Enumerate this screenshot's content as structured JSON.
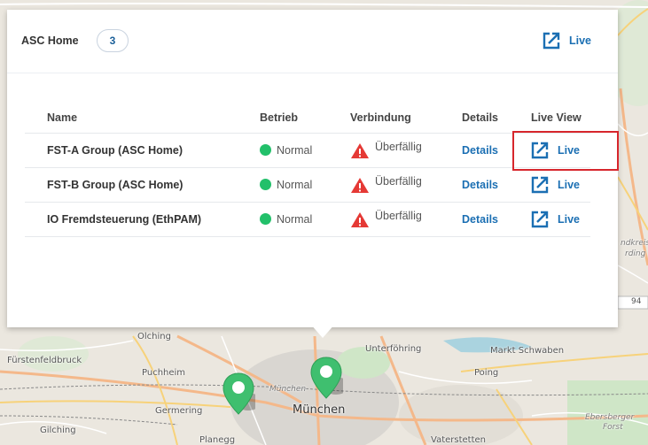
{
  "map": {
    "labels": [
      {
        "id": "olching",
        "text": "Olching"
      },
      {
        "id": "fuerstenfeldbruck",
        "text": "Fürstenfeldbruck"
      },
      {
        "id": "puchheim",
        "text": "Puchheim"
      },
      {
        "id": "germering",
        "text": "Germering"
      },
      {
        "id": "gilching",
        "text": "Gilching"
      },
      {
        "id": "planegg",
        "text": "Planegg"
      },
      {
        "id": "unterfoehring",
        "text": "Unterföhring"
      },
      {
        "id": "muenchen",
        "text": "München"
      },
      {
        "id": "muenchen_italic",
        "text": "München"
      },
      {
        "id": "markt_schwaben",
        "text": "Markt Schwaben"
      },
      {
        "id": "poing",
        "text": "Poing"
      },
      {
        "id": "vaterstetten",
        "text": "Vaterstetten"
      },
      {
        "id": "ebersberger",
        "text": "Ebersberger"
      },
      {
        "id": "forst",
        "text": "Forst"
      },
      {
        "id": "kreis",
        "text": "ndkreis"
      },
      {
        "id": "rding",
        "text": "rding"
      },
      {
        "id": "road_94",
        "text": "94"
      }
    ]
  },
  "popup": {
    "group_title": "ASC Home",
    "count": "3",
    "header_live_label": "Live",
    "columns": [
      "Name",
      "Betrieb",
      "Verbindung",
      "Details",
      "Live View"
    ],
    "rows": [
      {
        "name": "FST-A Group (ASC Home)",
        "betrieb": "Normal",
        "verbindung": "Überfällig",
        "details": "Details",
        "live": "Live"
      },
      {
        "name": "FST-B Group (ASC Home)",
        "betrieb": "Normal",
        "verbindung": "Überfällig",
        "details": "Details",
        "live": "Live"
      },
      {
        "name": "IO Fremdsteuerung (EthPAM)",
        "betrieb": "Normal",
        "verbindung": "Überfällig",
        "details": "Details",
        "live": "Live"
      }
    ]
  },
  "colors": {
    "accent": "#1b6fb3",
    "status_normal": "#22c06a",
    "status_warning": "#e53935",
    "highlight": "#d7262c",
    "pin": "#3fbf6f"
  }
}
